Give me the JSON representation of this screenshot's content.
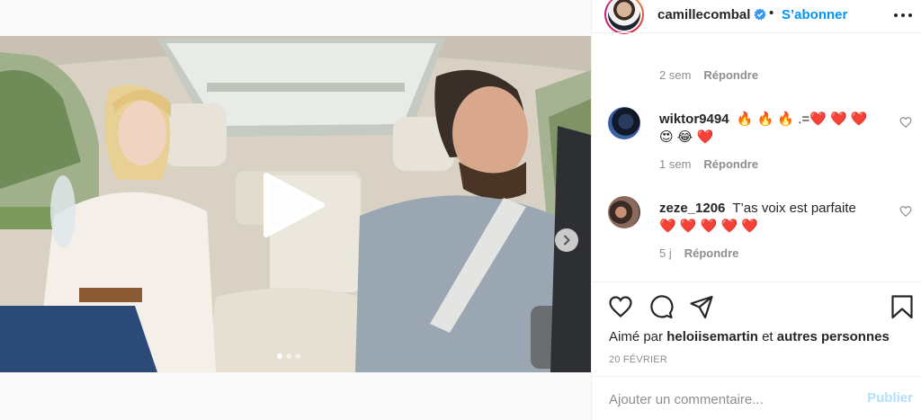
{
  "post": {
    "media_dots_count": 3,
    "active_dot": 0
  },
  "header": {
    "username": "camillecombal",
    "separator": "•",
    "follow_label": "S’abonner"
  },
  "comments": {
    "first_meta": {
      "time": "2 sem",
      "reply": "Répondre"
    },
    "items": [
      {
        "username": "wiktor9494",
        "text": "🔥 🔥 🔥 .=❤️ ❤️ ❤️ 😍 😂 ❤️",
        "time": "1 sem",
        "reply": "Répondre"
      },
      {
        "username": "zeze_1206",
        "text": "T’as voix est parfaite ❤️ ❤️ ❤️ ❤️ ❤️",
        "time": "5 j",
        "reply": "Répondre"
      }
    ]
  },
  "likes": {
    "prefix": "Aimé par",
    "liker": "heloiisemartin",
    "connector": "et",
    "others": "autres personnes"
  },
  "date": "20 FÉVRIER",
  "add_comment": {
    "placeholder": "Ajouter un commentaire...",
    "publish_label": "Publier"
  },
  "colors": {
    "link_blue": "#0095f6",
    "publish_disabled": "#b2dffc",
    "muted": "#8e8e8e",
    "text": "#262626"
  },
  "icons": [
    "verified-badge-icon",
    "more-options-icon",
    "heart-icon",
    "comment-icon",
    "share-icon",
    "bookmark-icon",
    "play-icon",
    "chevron-right-icon"
  ]
}
